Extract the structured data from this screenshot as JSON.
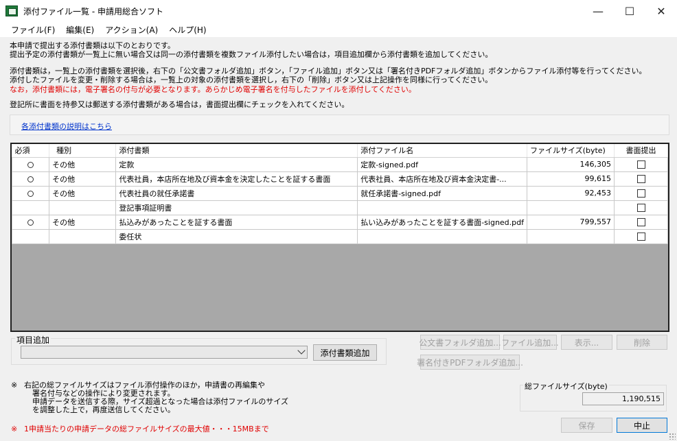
{
  "window": {
    "title": "添付ファイル一覧 - 申請用総合ソフト",
    "minimize": "—",
    "maximize": "☐",
    "close": "✕"
  },
  "menu": [
    "ファイル(F)",
    "編集(E)",
    "アクション(A)",
    "ヘルプ(H)"
  ],
  "info": {
    "line1": "本申請で提出する添付書類は以下のとおりです。",
    "line2": "提出予定の添付書類が一覧上に無い場合又は同一の添付書類を複数ファイル添付したい場合は，項目追加欄から添付書類を追加してください。",
    "line3": "添付書類は，一覧上の添付書類を選択後，右下の「公文書フォルダ追加」ボタン，「ファイル追加」ボタン又は「署名付きPDFフォルダ追加」ボタンからファイル添付等を行ってください。",
    "line4": "添付したファイルを変更・削除する場合は，一覧上の対象の添付書類を選択し，右下の「削除」ボタン又は上記操作を同様に行ってください。",
    "line5_red": "なお，添付書類には，電子署名の付与が必要となります。あらかじめ電子署名を付与したファイルを添付してください。",
    "line6": "登記所に書面を持参又は郵送する添付書類がある場合は，書面提出欄にチェックを入れてください。",
    "link": "各添付書類の説明はこちら"
  },
  "table": {
    "headers": {
      "required": "必須",
      "type": "種別",
      "document": "添付書類",
      "filename": "添付ファイル名",
      "filesize": "ファイルサイズ(byte)",
      "paper": "書面提出"
    },
    "rows": [
      {
        "required": "○",
        "type": "その他",
        "document": "定款",
        "filename": "定款-signed.pdf",
        "filesize": "146,305"
      },
      {
        "required": "○",
        "type": "その他",
        "document": "代表社員，本店所在地及び資本金を決定したことを証する書面",
        "filename": "代表社員、本店所在地及び資本金決定書-...",
        "filesize": "99,615"
      },
      {
        "required": "○",
        "type": "その他",
        "document": "代表社員の就任承諾書",
        "filename": "就任承諾書-signed.pdf",
        "filesize": "92,453"
      },
      {
        "required": "",
        "type": "",
        "document": "登記事項証明書",
        "filename": "",
        "filesize": ""
      },
      {
        "required": "○",
        "type": "その他",
        "document": "払込みがあったことを証する書面",
        "filename": "払い込みがあったことを証する書面-signed.pdf",
        "filesize": "799,557"
      },
      {
        "required": "",
        "type": "",
        "document": "委任状",
        "filename": "",
        "filesize": ""
      }
    ]
  },
  "add_item": {
    "label": "項目追加",
    "select_value": "",
    "button": "添付書類追加"
  },
  "actions": {
    "official_folder": "公文書フォルダ追加...",
    "add_file": "ファイル追加...",
    "view": "表示...",
    "delete": "削除",
    "signed_pdf_folder": "署名付きPDFフォルダ追加..."
  },
  "notes": {
    "mark1": "※",
    "line1": "右記の総ファイルサイズはファイル添付操作のほか，申請書の再編集や",
    "line2": "署名付与などの操作により変更されます。",
    "line3": "申請データを送信する際，サイズ超過となった場合は添付ファイルのサイズ",
    "line4": "を調整した上で，再度送信してください。",
    "mark2": "※",
    "red": "1申請当たりの申請データの総ファイルサイズの最大値・・・15MBまで"
  },
  "total": {
    "label": "総ファイルサイズ(byte)",
    "value": "1,190,515"
  },
  "footer": {
    "save": "保存",
    "cancel": "中止"
  }
}
